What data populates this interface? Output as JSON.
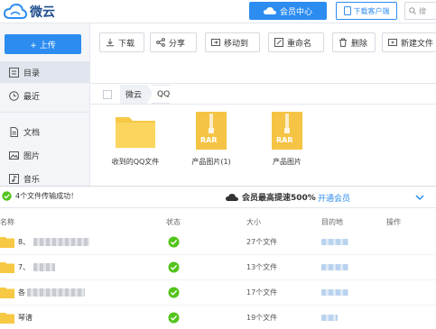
{
  "app": {
    "name": "微云",
    "vip_center": "会员中心",
    "download_client": "下载客户端",
    "search_placeholder": "搜"
  },
  "sidebar": {
    "upload_label": "+ 上传",
    "items": [
      {
        "label": "目录",
        "icon": "list-icon",
        "active": true
      },
      {
        "label": "最近",
        "icon": "clock-icon",
        "active": false
      },
      {
        "label": "文档",
        "icon": "document-icon",
        "active": false
      },
      {
        "label": "图片",
        "icon": "image-icon",
        "active": false
      },
      {
        "label": "音乐",
        "icon": "music-icon",
        "active": false
      }
    ]
  },
  "toolbar": {
    "buttons": [
      {
        "label": "下载",
        "icon": "download-icon"
      },
      {
        "label": "分享",
        "icon": "share-icon"
      },
      {
        "label": "移动到",
        "icon": "move-icon"
      },
      {
        "label": "重命名",
        "icon": "rename-icon"
      },
      {
        "label": "删除",
        "icon": "trash-icon"
      },
      {
        "label": "新建文件",
        "icon": "new-folder-icon"
      }
    ]
  },
  "breadcrumb": [
    "微云",
    "QQ"
  ],
  "files": [
    {
      "name": "收到的QQ文件",
      "type": "folder"
    },
    {
      "name": "产品图片(1)",
      "type": "rar"
    },
    {
      "name": "产品图片",
      "type": "rar"
    }
  ],
  "rar_label": "RAR",
  "transfer": {
    "status": "4个文件传输成功！",
    "promo": "会员最高提速500%",
    "open_vip": "开通会员",
    "columns": {
      "name": "名称",
      "status": "状态",
      "size": "大小",
      "destination": "目的地",
      "action": "操作"
    },
    "rows": [
      {
        "prefix": "8、",
        "size": "27个文件"
      },
      {
        "prefix": "7、",
        "size": "13个文件"
      },
      {
        "prefix": "各",
        "size": "17个文件"
      },
      {
        "prefix": "琴谱",
        "size": "19个文件"
      }
    ]
  },
  "colors": {
    "accent": "#2d8cf0",
    "success": "#52c41a",
    "folder": "#f7c843"
  }
}
